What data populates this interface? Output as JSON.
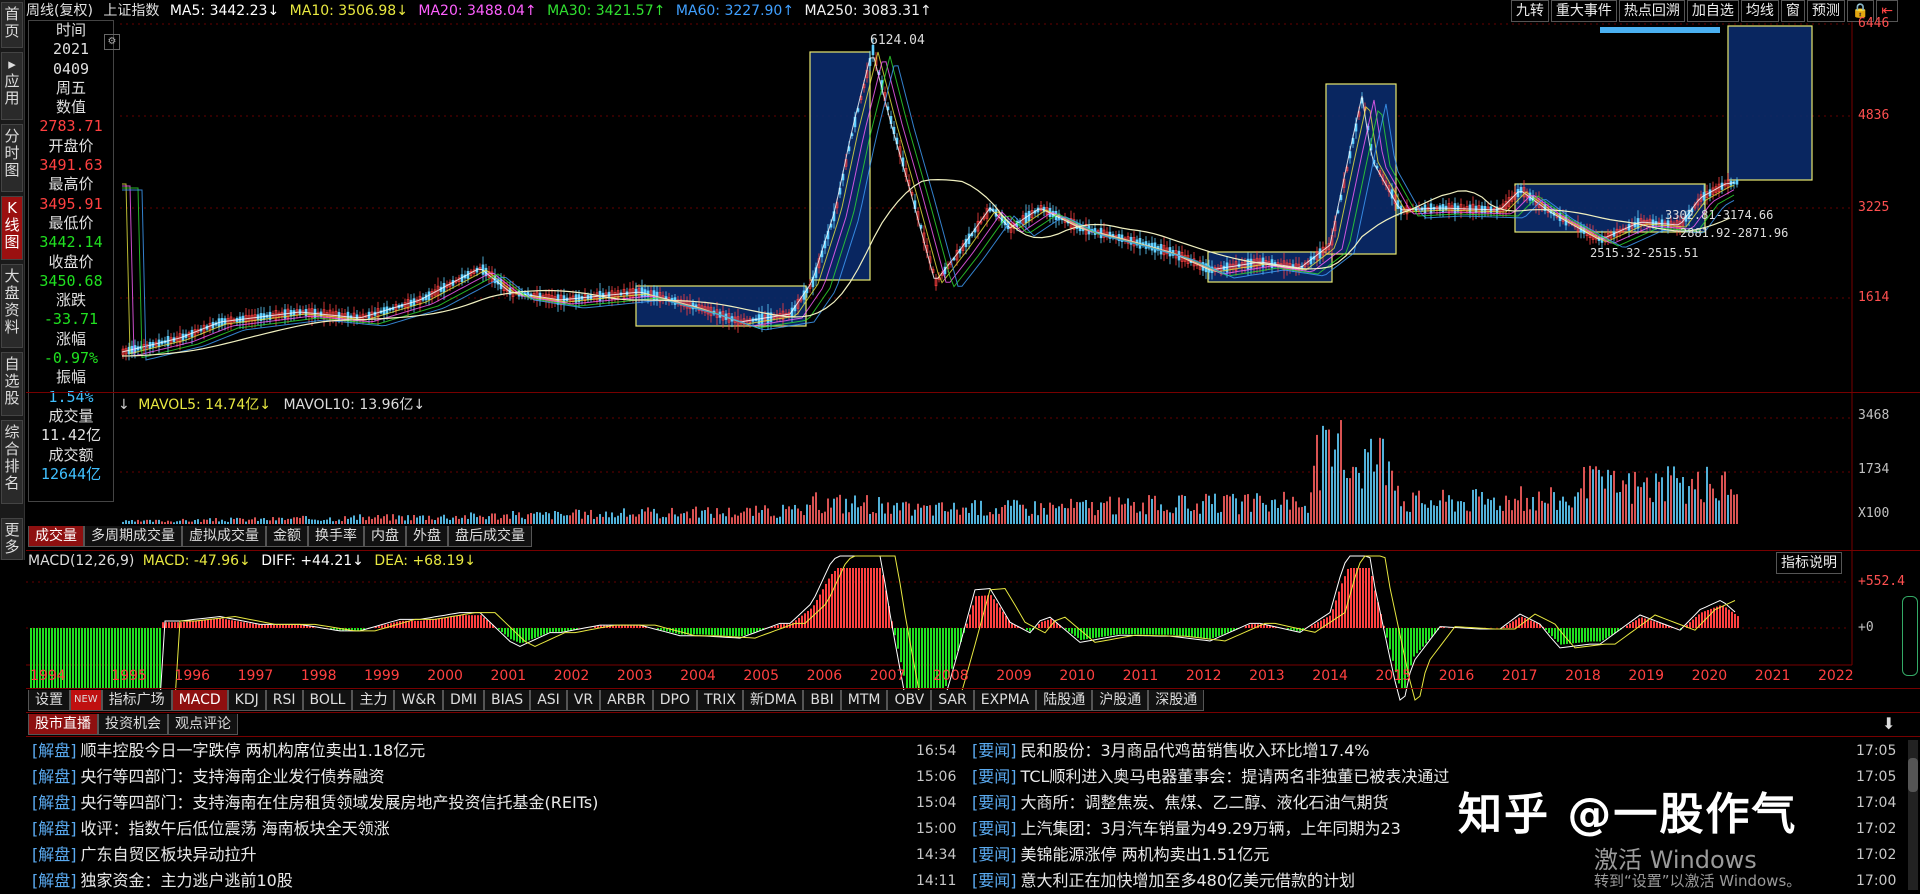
{
  "left_nav": [
    {
      "label": "首页",
      "active": false
    },
    {
      "label": "▸应用",
      "active": false
    },
    {
      "label": "分时图",
      "active": false
    },
    {
      "label": "K线图",
      "active": true
    },
    {
      "label": "大盘资料",
      "active": false
    },
    {
      "label": "自选股",
      "active": false
    },
    {
      "label": "综合排名",
      "active": false
    },
    {
      "label": "更多",
      "active": false
    }
  ],
  "topbar": {
    "chart_title": "周线(复权)",
    "index_name": "上证指数",
    "ma5": "MA5: 3442.23↓",
    "ma10": "MA10: 3506.98↓",
    "ma20": "MA20: 3488.04↑",
    "ma30": "MA30: 3421.57↑",
    "ma60": "MA60: 3227.90↑",
    "ma250": "MA250: 3083.31↑",
    "buttons": [
      "九转",
      "重大事件",
      "热点回溯",
      "加自选",
      "均线",
      "窗",
      "预测"
    ]
  },
  "info": [
    {
      "text": "时间",
      "label": true
    },
    {
      "text": "2021",
      "color": "#e0e0e0"
    },
    {
      "text": "0409",
      "color": "#e0e0e0"
    },
    {
      "text": "周五",
      "label": true
    },
    {
      "text": "数值",
      "label": true
    },
    {
      "text": "2783.71",
      "color": "#ff4040"
    },
    {
      "text": "开盘价",
      "label": true
    },
    {
      "text": "3491.63",
      "color": "#ff4040"
    },
    {
      "text": "最高价",
      "label": true
    },
    {
      "text": "3495.91",
      "color": "#ff4040"
    },
    {
      "text": "最低价",
      "label": true
    },
    {
      "text": "3442.14",
      "color": "#20e020"
    },
    {
      "text": "收盘价",
      "label": true
    },
    {
      "text": "3450.68",
      "color": "#20e020"
    },
    {
      "text": "涨跌",
      "label": true
    },
    {
      "text": "-33.71",
      "color": "#20e020"
    },
    {
      "text": "涨幅",
      "label": true
    },
    {
      "text": "-0.97%",
      "color": "#20e020"
    },
    {
      "text": "振幅",
      "label": true
    },
    {
      "text": "1.54%",
      "color": "#40c0ff"
    },
    {
      "text": "成交量",
      "label": true
    },
    {
      "text": "11.42亿",
      "color": "#e0e0e0"
    },
    {
      "text": "成交额",
      "label": true
    },
    {
      "text": "12644亿",
      "color": "#40c0ff"
    }
  ],
  "price_axis": [
    "6446",
    "4836",
    "3225",
    "1614"
  ],
  "annotations": {
    "peak": "6124.04",
    "a1": "3302.81-3174.66",
    "a2": "2881.92-2871.96",
    "a3": "2515.32-2515.51"
  },
  "volume": {
    "header_a": "↓",
    "header_b": "MAVOL5: 14.74亿↓",
    "header_c": "MAVOL10: 13.96亿↓",
    "axis": [
      "3468",
      "1734",
      "X100"
    ]
  },
  "volume_tabs": [
    "成交量",
    "多周期成交量",
    "虚拟成交量",
    "金额",
    "换手率",
    "内盘",
    "外盘",
    "盘后成交量"
  ],
  "macd": {
    "name": "MACD(12,26,9)",
    "macd": "MACD: -47.96↓",
    "diff": "DIFF: +44.21↓",
    "dea": "DEA: +68.19↓",
    "explain_btn": "指标说明",
    "axis": [
      "+552.4",
      "+0"
    ]
  },
  "years": [
    "1994",
    "1995",
    "1996",
    "1997",
    "1998",
    "1999",
    "2000",
    "2001",
    "2002",
    "2003",
    "2004",
    "2005",
    "2006",
    "2007",
    "2008",
    "2009",
    "2010",
    "2011",
    "2012",
    "2013",
    "2014",
    "2015",
    "2016",
    "2017",
    "2018",
    "2019",
    "2020",
    "2021",
    "2022"
  ],
  "indicator_tabs": [
    "设置",
    "NEW",
    "指标广场",
    "MACD",
    "KDJ",
    "RSI",
    "BOLL",
    "主力",
    "W&R",
    "DMI",
    "BIAS",
    "ASI",
    "VR",
    "ARBR",
    "DPO",
    "TRIX",
    "新DMA",
    "BBI",
    "MTM",
    "OBV",
    "SAR",
    "EXPMA",
    "陆股通",
    "沪股通",
    "深股通"
  ],
  "news_tabs": [
    "股市直播",
    "投资机会",
    "观点评论"
  ],
  "news_left": [
    {
      "tag": "[解盘]",
      "text": "顺丰控股今日一字跌停 两机构席位卖出1.18亿元",
      "time": "16:54"
    },
    {
      "tag": "[解盘]",
      "text": "央行等四部门：支持海南企业发行债券融资",
      "time": "15:06"
    },
    {
      "tag": "[解盘]",
      "text": "央行等四部门：支持海南在住房租赁领域发展房地产投资信托基金(REITs)",
      "time": "15:04"
    },
    {
      "tag": "[解盘]",
      "text": "收评：指数午后低位震荡 海南板块全天领涨",
      "time": "15:00"
    },
    {
      "tag": "[解盘]",
      "text": "广东自贸区板块异动拉升",
      "time": "14:34"
    },
    {
      "tag": "[解盘]",
      "text": "独家资金：主力逃户逃前10股",
      "time": "14:11"
    }
  ],
  "news_right": [
    {
      "tag": "[要闻]",
      "text": "民和股份：3月商品代鸡苗销售收入环比增17.4%",
      "time": "17:05"
    },
    {
      "tag": "[要闻]",
      "text": "TCL顺利进入奥马电器董事会：提请两名非独董已被表决通过",
      "time": "17:05"
    },
    {
      "tag": "[要闻]",
      "text": "大商所：调整焦炭、焦煤、乙二醇、液化石油气期货",
      "time": "17:04"
    },
    {
      "tag": "[要闻]",
      "text": "上汽集团：3月汽车销量为49.29万辆，上年同期为23",
      "time": "17:02"
    },
    {
      "tag": "[要闻]",
      "text": "美锦能源涨停 两机构卖出1.51亿元",
      "time": "17:02"
    },
    {
      "tag": "[要闻]",
      "text": "意大利正在加快增加至多480亿美元借款的计划",
      "time": "17:00"
    }
  ],
  "watermark": {
    "brand": "知乎 @一股作气",
    "activate": "激活 Windows",
    "activate_sub": "转到“设置”以激活 Windows。"
  },
  "colors": {
    "up": "#ff4040",
    "down": "#20e020",
    "box_fill": "#0a2a6a",
    "box_stroke": "#e8e870",
    "accent": "#8e1010"
  }
}
